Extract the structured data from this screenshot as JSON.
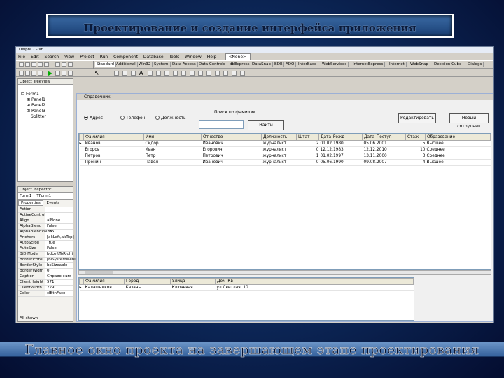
{
  "slide": {
    "title": "Проектирование и создание интерфейса приложения",
    "caption": "Главное окно проекта на завершающем этапе проектирования"
  },
  "ide": {
    "title": "Delphi 7 - xb",
    "menu": [
      "File",
      "Edit",
      "Search",
      "View",
      "Project",
      "Run",
      "Component",
      "Database",
      "Tools",
      "Window",
      "Help"
    ],
    "desktop_select": "<None>",
    "palette_tabs": [
      "Standard",
      "Additional",
      "Win32",
      "System",
      "Data Access",
      "Data Controls",
      "dbExpress",
      "DataSnap",
      "BDE",
      "ADO",
      "InterBase",
      "WebServices",
      "InternetExpress",
      "Internet",
      "WebSnap",
      "Decision Cube",
      "Dialogs"
    ]
  },
  "tree": {
    "title": "Object TreeView",
    "items": [
      "Form1",
      "Panel1",
      "Panel2",
      "Panel3",
      "Splitter"
    ]
  },
  "inspector": {
    "title": "Object Inspector",
    "object": "Form1",
    "object_type": "TForm1",
    "tabs": [
      "Properties",
      "Events"
    ],
    "rows": [
      {
        "name": "Action",
        "value": ""
      },
      {
        "name": "ActiveControl",
        "value": ""
      },
      {
        "name": "Align",
        "value": "alNone"
      },
      {
        "name": "AlphaBlend",
        "value": "False"
      },
      {
        "name": "AlphaBlendValue",
        "value": "255"
      },
      {
        "name": "Anchors",
        "value": "[akLeft,akTop]"
      },
      {
        "name": "AutoScroll",
        "value": "True"
      },
      {
        "name": "AutoSize",
        "value": "False"
      },
      {
        "name": "BiDiMode",
        "value": "bdLeftToRight"
      },
      {
        "name": "BorderIcons",
        "value": "[biSystemMenu]"
      },
      {
        "name": "BorderStyle",
        "value": "bsSizeable"
      },
      {
        "name": "BorderWidth",
        "value": "0"
      },
      {
        "name": "Caption",
        "value": "Справочник"
      },
      {
        "name": "ClientHeight",
        "value": "571"
      },
      {
        "name": "ClientWidth",
        "value": "729"
      },
      {
        "name": "Color",
        "value": "clBtnFace"
      }
    ],
    "status": "All shown"
  },
  "form": {
    "title": "Справочник",
    "radios": [
      {
        "label": "Адрес",
        "checked": true
      },
      {
        "label": "Телефон",
        "checked": false
      },
      {
        "label": "Должность",
        "checked": false
      }
    ],
    "search_label": "Поиск по фамилии",
    "search_value": "",
    "find_button": "Найти",
    "edit_button": "Редактировать",
    "new_button": "Новый сотрудник",
    "columns": [
      "Фамилия",
      "Имя",
      "Отчество",
      "Должность",
      "Штат",
      "Дата_Рожд",
      "Дата_Поступ",
      "Стаж",
      "Образование"
    ],
    "rows": [
      [
        "Иванов",
        "Сидор",
        "Иванович",
        "журналист",
        "2",
        "01.02.1980",
        "05.06.2001",
        "5",
        "Высшее"
      ],
      [
        "Егоров",
        "Иван",
        "Егорович",
        "журналист",
        "0",
        "12.12.1983",
        "12.12.2010",
        "10",
        "Среднее"
      ],
      [
        "Петров",
        "Петр",
        "Петрович",
        "журналист",
        "1",
        "01.02.1997",
        "13.11.2000",
        "3",
        "Среднее"
      ],
      [
        "Пронин",
        "Павел",
        "Иванович",
        "журналист",
        "0",
        "05.06.1990",
        "09.08.2007",
        "4",
        "Высшее"
      ]
    ],
    "detail_columns": [
      "Фамилия",
      "Город",
      "Улица",
      "Дом_Кв"
    ],
    "detail_rows": [
      [
        "Калашников",
        "Казань",
        "Ключевая",
        "ул.Светлая, 10"
      ]
    ]
  }
}
